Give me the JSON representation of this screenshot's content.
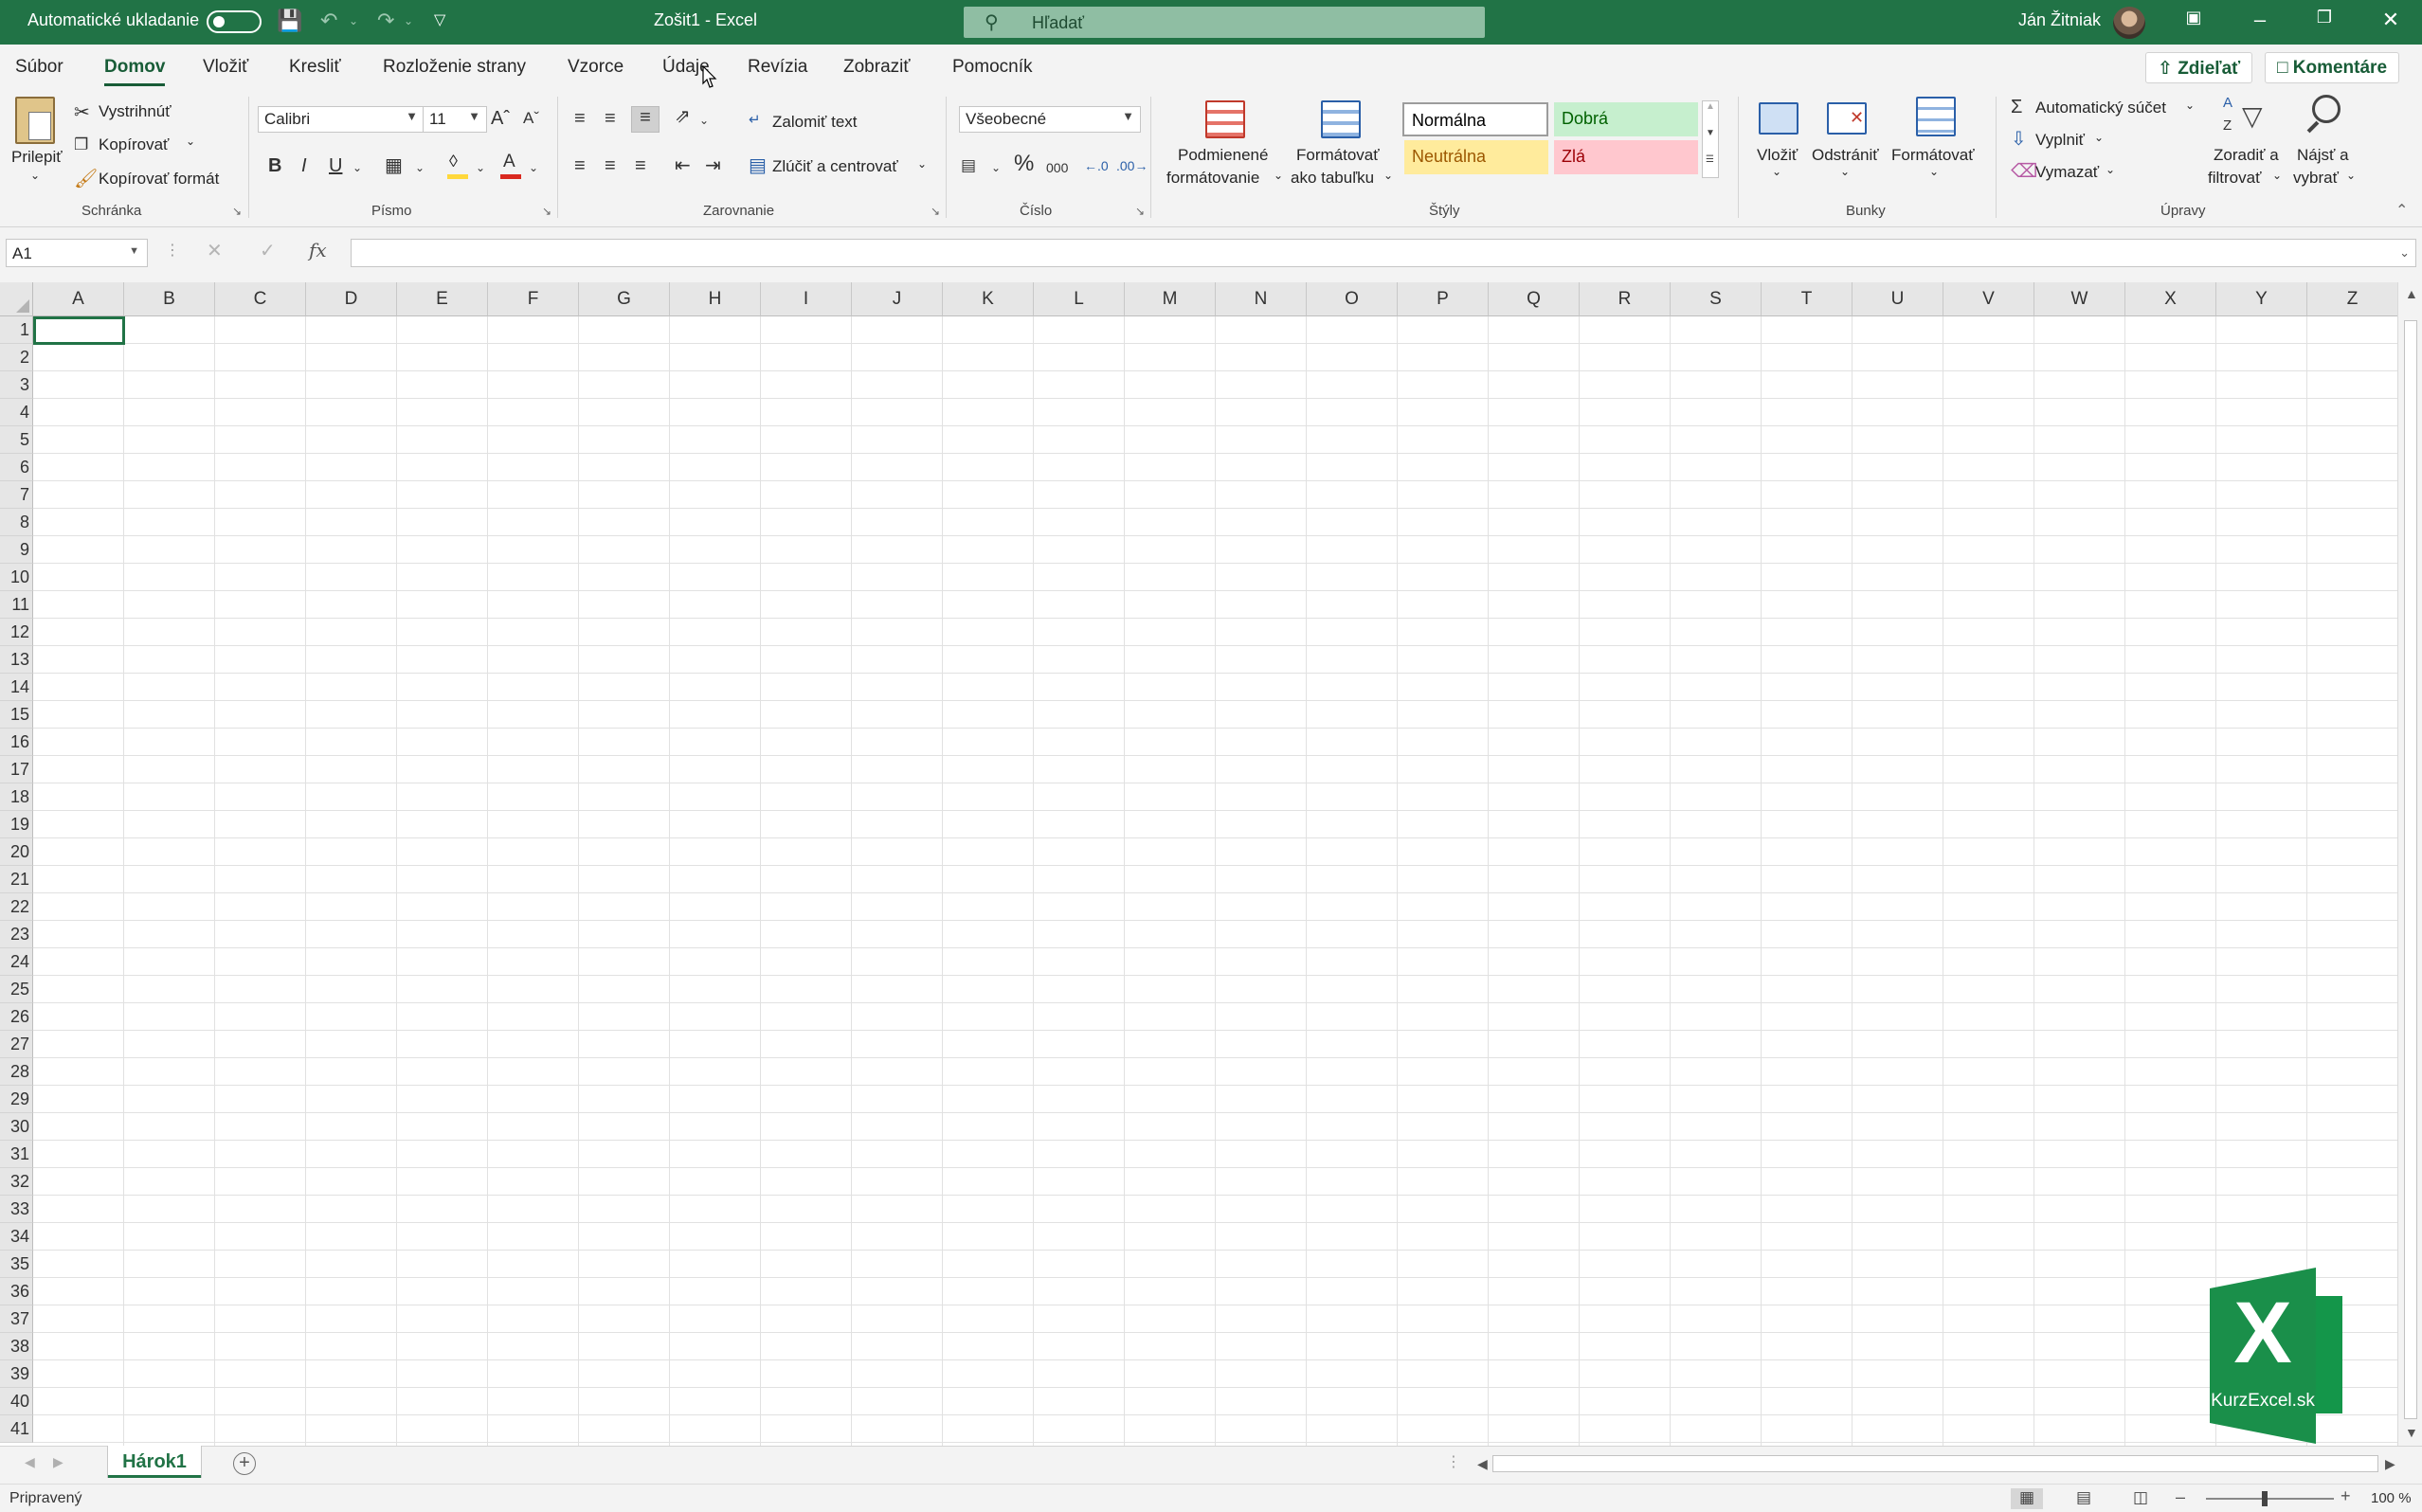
{
  "titlebar": {
    "autosave_label": "Automatické ukladanie",
    "doc_title": "Zošit1  -  Excel",
    "search_placeholder": "Hľadať",
    "user_name": "Ján Žitniak",
    "icons": [
      "save-icon",
      "undo-icon",
      "redo-icon",
      "customize-toolbar-icon",
      "ribbon-display-icon",
      "minimize-icon",
      "restore-icon",
      "close-icon"
    ],
    "accent": "#217346"
  },
  "menu": {
    "tabs": [
      "Súbor",
      "Domov",
      "Vložiť",
      "Kresliť",
      "Rozloženie strany",
      "Vzorce",
      "Údaje",
      "Revízia",
      "Zobraziť",
      "Pomocník"
    ],
    "active": "Domov",
    "share_label": "Zdieľať",
    "comments_label": "Komentáre"
  },
  "ribbon": {
    "clipboard": {
      "paste": "Prilepiť",
      "cut": "Vystrihnúť",
      "copy": "Kopírovať",
      "format_painter": "Kopírovať formát",
      "group": "Schránka"
    },
    "font": {
      "name": "Calibri",
      "size": "11",
      "bold": "B",
      "italic": "I",
      "underline": "U",
      "group": "Písmo"
    },
    "alignment": {
      "wrap": "Zalomiť text",
      "merge": "Zlúčiť a centrovať",
      "group": "Zarovnanie"
    },
    "number": {
      "format": "Všeobecné",
      "percent": "%",
      "thousands": "000",
      "group": "Číslo"
    },
    "styles": {
      "conditional_line1": "Podmienené",
      "conditional_line2": "formátovanie",
      "table_line1": "Formátovať",
      "table_line2": "ako tabuľku",
      "normal": "Normálna",
      "good": "Dobrá",
      "neutral": "Neutrálna",
      "bad": "Zlá",
      "group": "Štýly"
    },
    "cells": {
      "insert": "Vložiť",
      "delete": "Odstrániť",
      "format": "Formátovať",
      "group": "Bunky"
    },
    "editing": {
      "autosum": "Automatický súčet",
      "fill": "Vyplniť",
      "clear": "Vymazať",
      "sort_line1": "Zoradiť a",
      "sort_line2": "filtrovať",
      "find_line1": "Nájsť a",
      "find_line2": "vybrať",
      "group": "Úpravy"
    }
  },
  "formula_bar": {
    "name_box": "A1",
    "fx": "fx",
    "value": ""
  },
  "grid": {
    "columns": [
      "A",
      "B",
      "C",
      "D",
      "E",
      "F",
      "G",
      "H",
      "I",
      "J",
      "K",
      "L",
      "M",
      "N",
      "O",
      "P",
      "Q",
      "R",
      "S",
      "T",
      "U",
      "V",
      "W",
      "X",
      "Y",
      "Z"
    ],
    "rows": [
      "1",
      "2",
      "3",
      "4",
      "5",
      "6",
      "7",
      "8",
      "9",
      "10",
      "11",
      "12",
      "13",
      "14",
      "15",
      "16",
      "17",
      "18",
      "19",
      "20",
      "21",
      "22",
      "23",
      "24",
      "25",
      "26",
      "27",
      "28",
      "29",
      "30",
      "31",
      "32",
      "33",
      "34",
      "35",
      "36",
      "37",
      "38",
      "39",
      "40",
      "41"
    ],
    "selected_cell": "A1"
  },
  "sheets": {
    "tabs": [
      "Hárok1"
    ],
    "active": "Hárok1"
  },
  "status": {
    "ready": "Pripravený",
    "zoom": "100 %"
  },
  "watermark": {
    "letter": "X",
    "site": "KurzExcel.sk"
  }
}
